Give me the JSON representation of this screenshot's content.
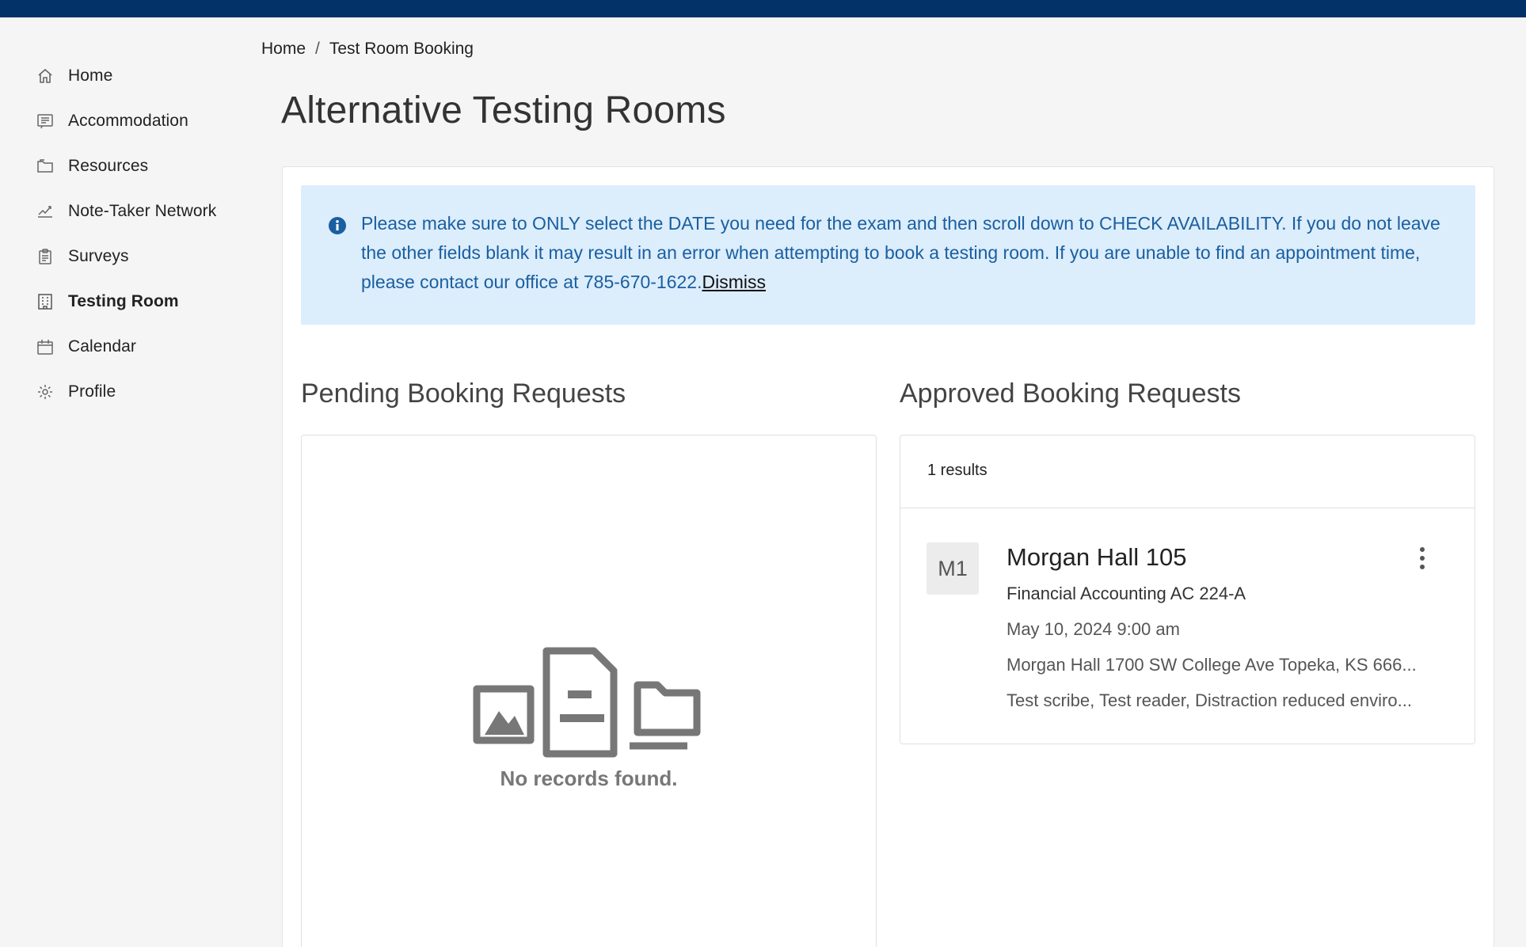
{
  "sidebar": {
    "items": [
      {
        "label": "Home",
        "icon": "home-icon"
      },
      {
        "label": "Accommodation",
        "icon": "list-icon"
      },
      {
        "label": "Resources",
        "icon": "folder-icon"
      },
      {
        "label": "Note-Taker Network",
        "icon": "signature-icon"
      },
      {
        "label": "Surveys",
        "icon": "clipboard-icon"
      },
      {
        "label": "Testing Room",
        "icon": "building-icon",
        "active": true
      },
      {
        "label": "Calendar",
        "icon": "calendar-icon"
      },
      {
        "label": "Profile",
        "icon": "gear-icon"
      }
    ]
  },
  "breadcrumb": {
    "home": "Home",
    "separator": "/",
    "current": "Test Room Booking"
  },
  "page": {
    "title": "Alternative Testing Rooms"
  },
  "banner": {
    "message": "Please make sure to ONLY select the DATE you need for the exam and then scroll down to CHECK AVAILABILITY. If you do not leave the other fields blank it may result in an error when attempting to book a testing room. If you are unable to find an appointment time, please contact our office at 785-670-1622.",
    "dismiss": "Dismiss"
  },
  "pending": {
    "title": "Pending Booking Requests",
    "empty_text": "No records found."
  },
  "approved": {
    "title": "Approved Booking Requests",
    "results": "1 results",
    "items": [
      {
        "avatar": "M1",
        "room": "Morgan Hall 105",
        "course": "Financial Accounting AC 224-A",
        "datetime": "May 10, 2024 9:00 am",
        "address": "Morgan Hall 1700 SW College Ave Topeka, KS 666...",
        "accommodations": "Test scribe, Test reader, Distraction reduced enviro..."
      }
    ]
  },
  "colors": {
    "topbar": "#033268",
    "banner_bg": "#dcedfc",
    "banner_text": "#1a5fa0"
  }
}
